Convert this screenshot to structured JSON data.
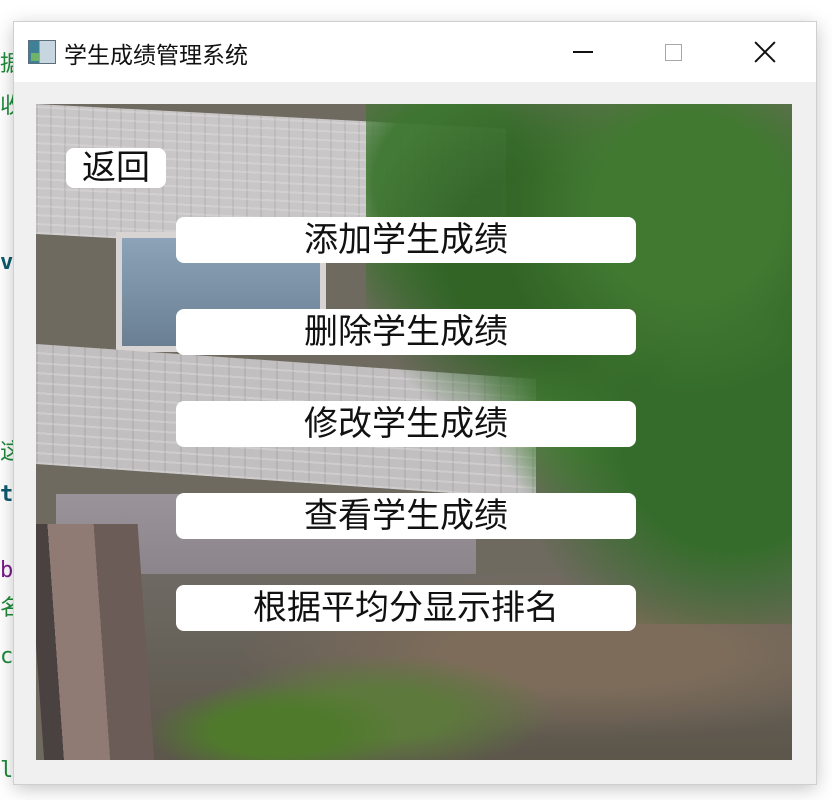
{
  "window": {
    "title": "学生成绩管理系统",
    "controls": {
      "minimize": "minimize",
      "maximize": "maximize",
      "close": "close"
    }
  },
  "main": {
    "back_label": "返回",
    "buttons": [
      {
        "label": "添加学生成绩"
      },
      {
        "label": "删除学生成绩"
      },
      {
        "label": "修改学生成绩"
      },
      {
        "label": "查看学生成绩"
      },
      {
        "label": "根据平均分显示排名"
      }
    ]
  },
  "background_editor": {
    "fragments": [
      "据",
      "收",
      "vi",
      "这",
      "t",
      "b",
      "名",
      "c",
      "l"
    ]
  },
  "colors": {
    "window_bg": "#f0f0f0",
    "titlebar_bg": "#ffffff",
    "button_bg": "#ffffff",
    "text": "#111111"
  }
}
